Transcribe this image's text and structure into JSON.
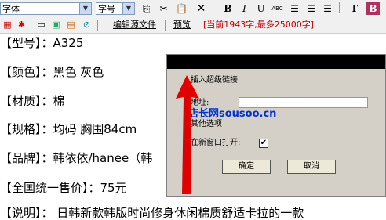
{
  "toolbar1": {
    "font_select": "字体",
    "size_select": "字号",
    "icons": [
      "copy-icon",
      "cut-icon",
      "paste-icon",
      "delete-icon",
      "bold-icon",
      "italic-icon",
      "underline-icon",
      "strikethrough-icon",
      "align-left-icon",
      "align-center-icon",
      "align-right-icon",
      "text-color-icon",
      "background-color-icon"
    ],
    "bold": "B",
    "italic": "I",
    "underline": "U",
    "strike": "ABC",
    "textcolor": "T",
    "bgcolor": "B"
  },
  "toolbar2": {
    "edit_source": "编辑源文件",
    "preview": "预览",
    "counter": "[当前1943字,最多25000字]"
  },
  "content": {
    "lines": [
      "【型号】：A325",
      "【颜色】：黑色 灰色",
      "【材质】：棉",
      "【规格】：均码  胸围84cm",
      "【品牌】：韩依依/hanee（韩",
      "【全国统一售价】：75元",
      "【说明】：   日韩新款韩版时尚修身休闲棉质舒适卡拉的一款"
    ]
  },
  "dialog": {
    "section_label": "插入超级链接",
    "address_label": "地址:",
    "address_value": "",
    "other_options": "其他选项",
    "new_window_label": "在新窗口打开:",
    "new_window_checked": "✔",
    "ok_label": "确定",
    "cancel_label": "取消"
  },
  "watermark": "店长网sousoo.cn",
  "colors": {
    "counter": "#c00000",
    "arrow": "#e00000",
    "watermark": "#0033cc"
  }
}
